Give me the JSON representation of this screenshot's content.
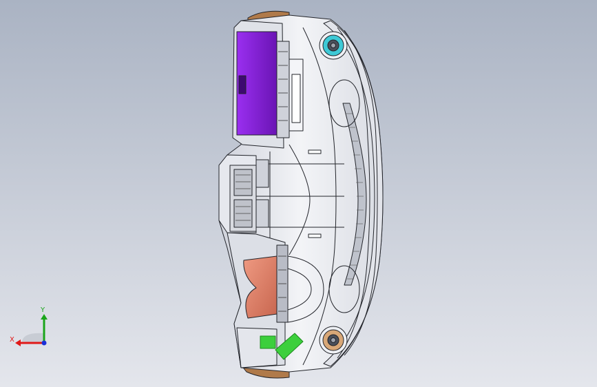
{
  "viewport": {
    "background_top": "#aab3c3",
    "background_bottom": "#e4e6ec"
  },
  "model": {
    "colors": {
      "shell": "#eef0f4",
      "shell_shade": "#d4d7df",
      "edge": "#22242a",
      "purple_panel": "#8a1fe0",
      "purple_panel_dark": "#5e10a0",
      "salmon_panel": "#e8826a",
      "salmon_panel_dark": "#b35a45",
      "bronze_trim": "#b07a4a",
      "speaker_cyan": "#3ec9d6",
      "speaker_tan": "#d8a777",
      "green_part": "#3ccf3c",
      "green_part_dark": "#1e8a1e"
    }
  },
  "triad": {
    "y_label": "Y",
    "x_label": "X",
    "colors": {
      "x": "#e01818",
      "y": "#1aa51a",
      "z": "#1a2fd8"
    }
  }
}
